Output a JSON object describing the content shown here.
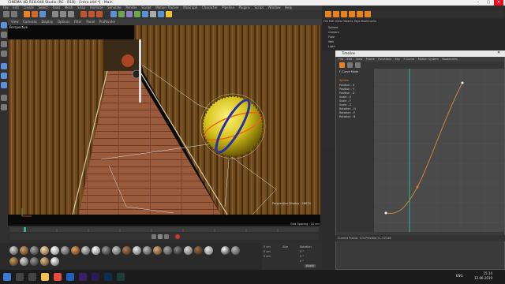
{
  "titlebar": {
    "title": "CINEMA 4D R18.048 Studio (RC - R18) - [intro.c4d *] - Main"
  },
  "menu": [
    "File",
    "Edit",
    "Create",
    "Select",
    "Tools",
    "Mesh",
    "Snap",
    "Animate",
    "Simulate",
    "Render",
    "Sculpt",
    "Motion Tracker",
    "MoGraph",
    "Character",
    "Pipeline",
    "Plugins",
    "Script",
    "Window",
    "Help"
  ],
  "viewport": {
    "menu": [
      "View",
      "Cameras",
      "Display",
      "Options",
      "Filter",
      "Panel",
      "ProRender"
    ],
    "label": "Perspective",
    "info": "Perspective Display : 16874",
    "grid": "Grid Spacing : 10 cm"
  },
  "timeline_window": {
    "title": "Timeline",
    "menu": [
      "File",
      "Edit",
      "View",
      "Frame",
      "Functions",
      "Key",
      "F-Curve",
      "Motion System",
      "Bookmarks"
    ],
    "mode": "F-Curve Mode",
    "tracks": [
      "Sphere",
      "Position . X",
      "Position . Y",
      "Position . Z",
      "Scale . X",
      "Scale . Y",
      "Scale . Z",
      "Rotation . H",
      "Rotation . P",
      "Rotation . B"
    ],
    "status": "Current Frame: 174  Preview: 0-->2148"
  },
  "object_manager": {
    "menu": [
      "File",
      "Edit",
      "View",
      "Objects",
      "Tags",
      "Bookmarks"
    ],
    "objects": [
      "Sphere",
      "Camera",
      "Floor",
      "Wall",
      "Light"
    ]
  },
  "coords": {
    "size_label": "Size",
    "rot_label": "Rotation",
    "apply_label": "Apply",
    "values": [
      "0 cm",
      "0 cm",
      "0 cm",
      "0 °",
      "0 °",
      "0 °"
    ]
  },
  "taskbar": {
    "time": "15:14",
    "date": "12.06.2019",
    "lang": "ENG"
  },
  "icons": [
    "windows-icon",
    "search-icon",
    "task-view-icon",
    "explorer-icon",
    "chrome-icon",
    "cinema4d-icon",
    "premiere-icon",
    "aftereffects-icon",
    "photoshop-icon",
    "media-encoder-icon"
  ],
  "colors": {
    "c4d_accent": "#5b8fd6",
    "keyframe_orange": "#e8821e",
    "playhead": "#2fb398"
  }
}
